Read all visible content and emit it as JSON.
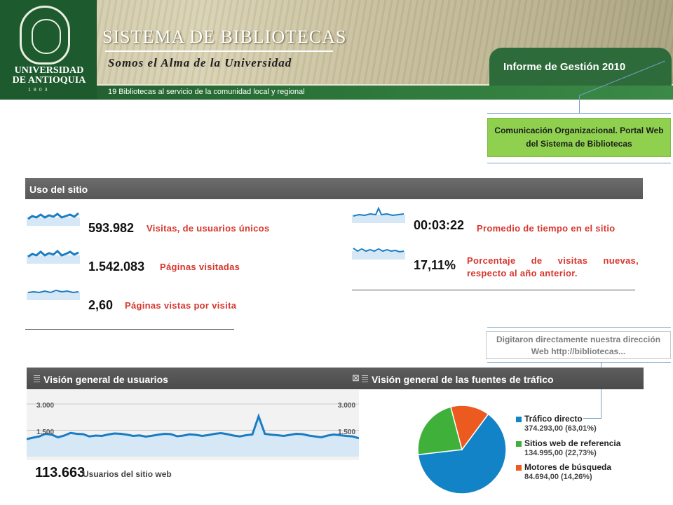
{
  "header": {
    "university": "UNIVERSIDAD DE ANTIOQUIA",
    "founded": "1803",
    "system_title": "SISTEMA DE BIBLIOTECAS",
    "slogan": "Somos el Alma de la Universidad",
    "strip_text": "19 Bibliotecas al servicio de la comunidad local y regional",
    "report_title": "Informe de Gestión 2010"
  },
  "callout": {
    "text": "Comunicación Organizacional. Portal Web del Sistema de Bibliotecas"
  },
  "site_usage": {
    "title": "Uso del sitio",
    "metrics_left": [
      {
        "value": "593.982",
        "label": "Visitas, de usuarios únicos"
      },
      {
        "value": "1.542.083",
        "label": "Páginas visitadas"
      },
      {
        "value": "2,60",
        "label": "Páginas vistas por visita"
      }
    ],
    "metrics_right": [
      {
        "value": "00:03:22",
        "label": "Promedio de tiempo en el sitio"
      },
      {
        "value": "17,11%",
        "label": "Porcentaje de visitas nuevas, respecto al año anterior."
      }
    ]
  },
  "note": {
    "text": "Digitaron directamente nuestra dirección Web http://bibliotecas..."
  },
  "users_panel": {
    "title": "Visión general de usuarios",
    "close_icon": "close-icon",
    "y_ticks": [
      "3.000",
      "1.500"
    ],
    "y_ticks_right": [
      "3.000",
      "1.500"
    ],
    "total_value": "113.663",
    "total_label": "Usuarios del sitio web"
  },
  "traffic_panel": {
    "title": "Visión general de las fuentes de tráfico"
  },
  "chart_data": [
    {
      "type": "line",
      "title": "Visión general de usuarios",
      "ylim": [
        0,
        3000
      ],
      "grid": true,
      "series": [
        {
          "values": [
            1000,
            1080,
            1150,
            1300,
            1250,
            1100,
            1200,
            1350,
            1300,
            1280,
            1150,
            1200,
            1180,
            1260,
            1320,
            1300,
            1250,
            1180,
            1210,
            1140,
            1190,
            1250,
            1300,
            1280,
            1160,
            1200,
            1270,
            1240,
            1180,
            1230,
            1300,
            1340,
            1280,
            1200,
            1150,
            1220,
            1260,
            2300,
            1300,
            1250,
            1220,
            1180,
            1240,
            1300,
            1280,
            1200,
            1150,
            1100,
            1200,
            1260,
            1220,
            1180,
            1150,
            1050
          ]
        }
      ],
      "colors": {
        "line": "#1a7dc4",
        "fill": "#d6e8f5"
      }
    },
    {
      "type": "pie",
      "title": "Visión general de las fuentes de tráfico",
      "legend": "right",
      "slices": [
        {
          "name": "Tráfico directo",
          "value": 374293.0,
          "value_label": "374.293,00 (63,01%)",
          "percent": 63.01,
          "color": "#1283c6"
        },
        {
          "name": "Sitios web de referencia",
          "value": 134995.0,
          "value_label": "134.995,00 (22,73%)",
          "percent": 22.73,
          "color": "#3fb03a"
        },
        {
          "name": "Motores de búsqueda",
          "value": 84694.0,
          "value_label": "84.694,00 (14,26%)",
          "percent": 14.26,
          "color": "#ec5a1f"
        }
      ]
    }
  ],
  "colors": {
    "accent_green": "#8fd14f",
    "dark_green": "#2e6b3a",
    "metric_red": "#d6362d",
    "panel_gray": "#575757"
  }
}
